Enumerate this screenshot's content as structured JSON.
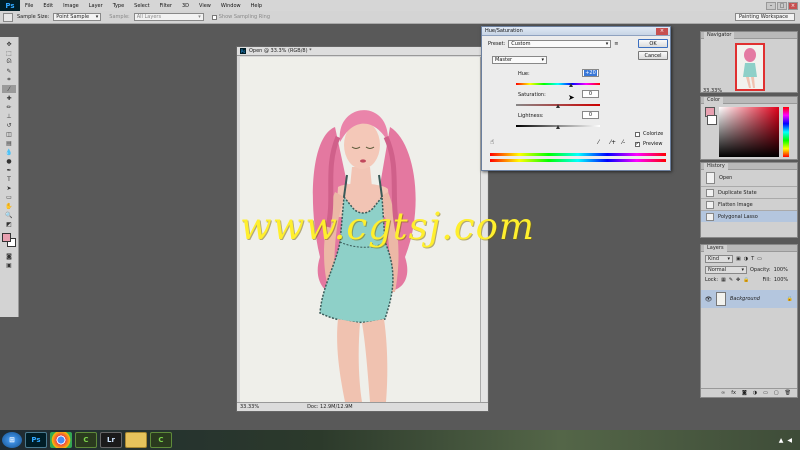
{
  "menu": {
    "items": [
      "File",
      "Edit",
      "Image",
      "Layer",
      "Type",
      "Select",
      "Filter",
      "3D",
      "View",
      "Window",
      "Help"
    ],
    "app_logo": "Ps"
  },
  "options": {
    "sample_size_label": "Sample Size:",
    "sample_size_value": "Point Sample",
    "sample_label": "Sample:",
    "sample_value": "All Layers",
    "show_ring_label": "Show Sampling Ring",
    "workspace": "Painting Workspace"
  },
  "document": {
    "title": "Open @ 33.3% (RGB/8) *",
    "zoom": "33.33%",
    "doc_info": "Doc: 12.9M/12.9M"
  },
  "hue_sat": {
    "title": "Hue/Saturation",
    "preset_label": "Preset:",
    "preset_value": "Custom",
    "channel": "Master",
    "hue_label": "Hue:",
    "hue_value": "+20",
    "saturation_label": "Saturation:",
    "saturation_value": "0",
    "lightness_label": "Lightness:",
    "lightness_value": "0",
    "colorize_label": "Colorize",
    "preview_label": "Preview",
    "ok_label": "OK",
    "cancel_label": "Cancel"
  },
  "panels": {
    "navigator": {
      "tab": "Navigator",
      "zoom": "33.33%"
    },
    "color": {
      "tab": "Color",
      "fg_color": "#e8a0b0"
    },
    "history": {
      "tab": "History",
      "snapshot": "Open",
      "items": [
        "Duplicate State",
        "Flatten Image",
        "Polygonal Lasso"
      ]
    },
    "layers": {
      "tab": "Layers",
      "kind": "Kind",
      "blend_mode": "Normal",
      "opacity_label": "Opacity:",
      "opacity_value": "100%",
      "lock_label": "Lock:",
      "fill_label": "Fill:",
      "fill_value": "100%",
      "layer_name": "Background"
    }
  },
  "watermark": "www.cgtsj.com",
  "taskbar": {
    "apps": [
      "start-icon",
      "photoshop-icon",
      "chrome-icon",
      "camtasia-icon",
      "lightroom-icon",
      "explorer-icon",
      "camtasia-icon"
    ],
    "ps_label": "Ps",
    "lr_label": "Lr",
    "cam_label": "C"
  },
  "colors": {
    "accent_blue": "#3978d8",
    "layer_selected": "#b4c6de",
    "watermark": "#ffef2e",
    "hair": "#e47aa2",
    "dress": "#8ed0c8"
  }
}
